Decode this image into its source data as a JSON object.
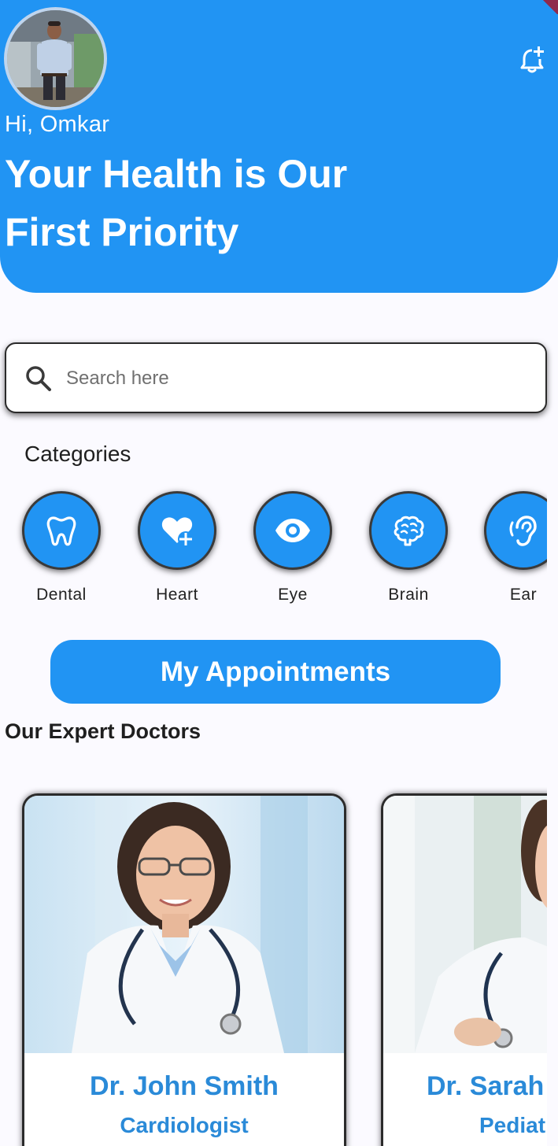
{
  "header": {
    "greeting": "Hi, Omkar",
    "tagline": "Your Health is Our First Priority",
    "avatar_icon": "user-avatar",
    "notification_icon": "bell-plus-icon",
    "background_color": "#2194F3"
  },
  "search": {
    "placeholder": "Search here",
    "value": "",
    "icon": "search-icon"
  },
  "categories": {
    "title": "Categories",
    "items": [
      {
        "label": "Dental",
        "icon": "tooth-icon"
      },
      {
        "label": "Heart",
        "icon": "heart-plus-icon"
      },
      {
        "label": "Eye",
        "icon": "eye-icon"
      },
      {
        "label": "Brain",
        "icon": "brain-icon"
      },
      {
        "label": "Ear",
        "icon": "ear-icon"
      }
    ]
  },
  "appointments_button": {
    "label": "My Appointments"
  },
  "doctors": {
    "title": "Our Expert Doctors",
    "items": [
      {
        "name": "Dr. John Smith",
        "specialty": "Cardiologist"
      },
      {
        "name": "Dr. Sarah",
        "specialty": "Pediat"
      }
    ]
  },
  "colors": {
    "primary": "#2194F3",
    "card_text": "#2A8AD8",
    "page_background": "#FBFAFF"
  }
}
